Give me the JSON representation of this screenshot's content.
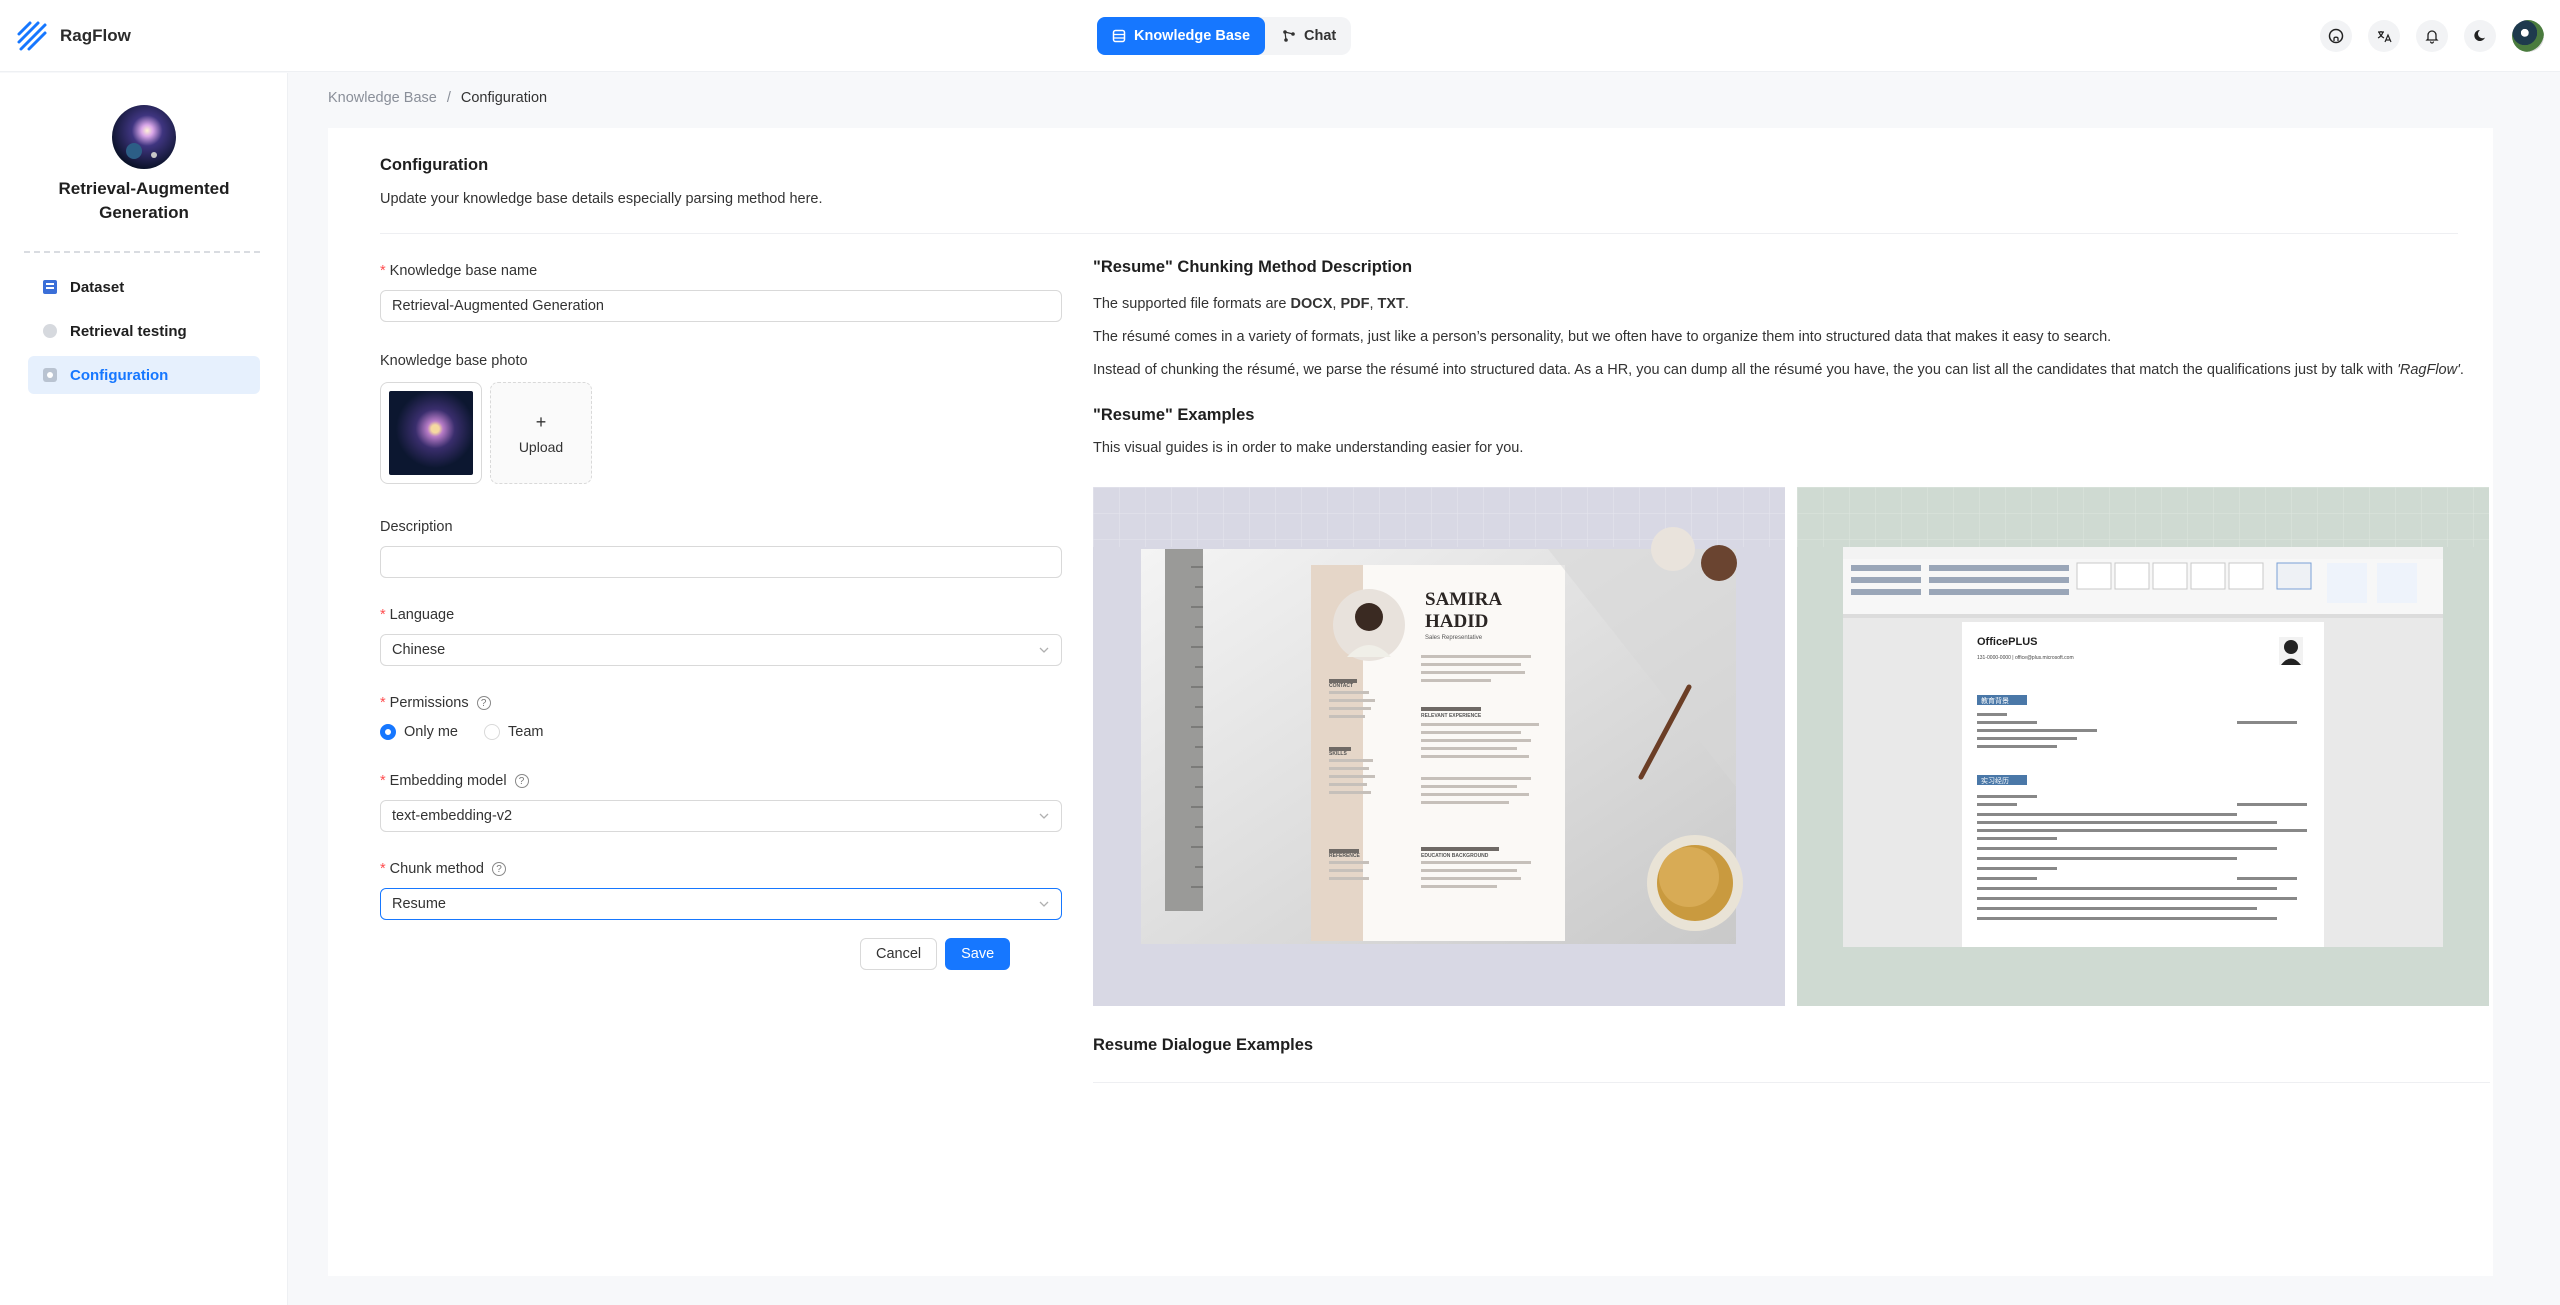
{
  "app": {
    "name": "RagFlow"
  },
  "nav": {
    "knowledge_base": "Knowledge Base",
    "chat": "Chat"
  },
  "sidebar": {
    "kb_name": "Retrieval-Augmented Generation",
    "items": [
      {
        "label": "Dataset"
      },
      {
        "label": "Retrieval testing"
      },
      {
        "label": "Configuration"
      }
    ]
  },
  "breadcrumb": {
    "root": "Knowledge Base",
    "sep": "/",
    "current": "Configuration"
  },
  "config": {
    "title": "Configuration",
    "subtitle": "Update your knowledge base details especially parsing method here."
  },
  "form": {
    "name_label": "Knowledge base name",
    "name_value": "Retrieval-Augmented Generation",
    "photo_label": "Knowledge base photo",
    "upload_plus": "+",
    "upload_label": "Upload",
    "description_label": "Description",
    "description_value": "",
    "language_label": "Language",
    "language_value": "Chinese",
    "permissions_label": "Permissions",
    "perm_only_me": "Only me",
    "perm_team": "Team",
    "embedding_label": "Embedding model",
    "embedding_value": "text-embedding-v2",
    "chunk_label": "Chunk method",
    "chunk_value": "Resume",
    "required_mark": "*",
    "help_mark": "?",
    "cancel": "Cancel",
    "save": "Save"
  },
  "description": {
    "heading": "\"Resume\" Chunking Method Description",
    "formats_prefix": "The supported file formats are ",
    "format_docx": "DOCX",
    "format_sep1": ", ",
    "format_pdf": "PDF",
    "format_sep2": ", ",
    "format_txt": "TXT",
    "formats_suffix": ".",
    "para2": "The résumé comes in a variety of formats, just like a person’s personality, but we often have to organize them into structured data that makes it easy to search.",
    "para3_prefix": "Instead of chunking the résumé, we parse the résumé into structured data. As a HR, you can dump all the résumé you have, the you can list all the candidates that match the qualifications just by talk with ",
    "para3_em": "'RagFlow'",
    "para3_suffix": ".",
    "examples_heading": "\"Resume\" Examples",
    "examples_sub": "This visual guides is in order to make understanding easier for you.",
    "dialog_heading": "Resume Dialogue Examples"
  },
  "example1": {
    "name_first": "SAMIRA",
    "name_last": "HADID",
    "role": "Sales Representative",
    "contact": "CONTACT",
    "skills": "SKILLS",
    "experience": "RELEVANT EXPERIENCE",
    "education": "EDUCATION BACKGROUND",
    "reference": "REFERENCE"
  },
  "example2": {
    "brand": "OfficePLUS",
    "phone": "131-0000-0000 | office@plus.microsoft.com",
    "section1": "教育背景",
    "section2": "实习经历"
  }
}
